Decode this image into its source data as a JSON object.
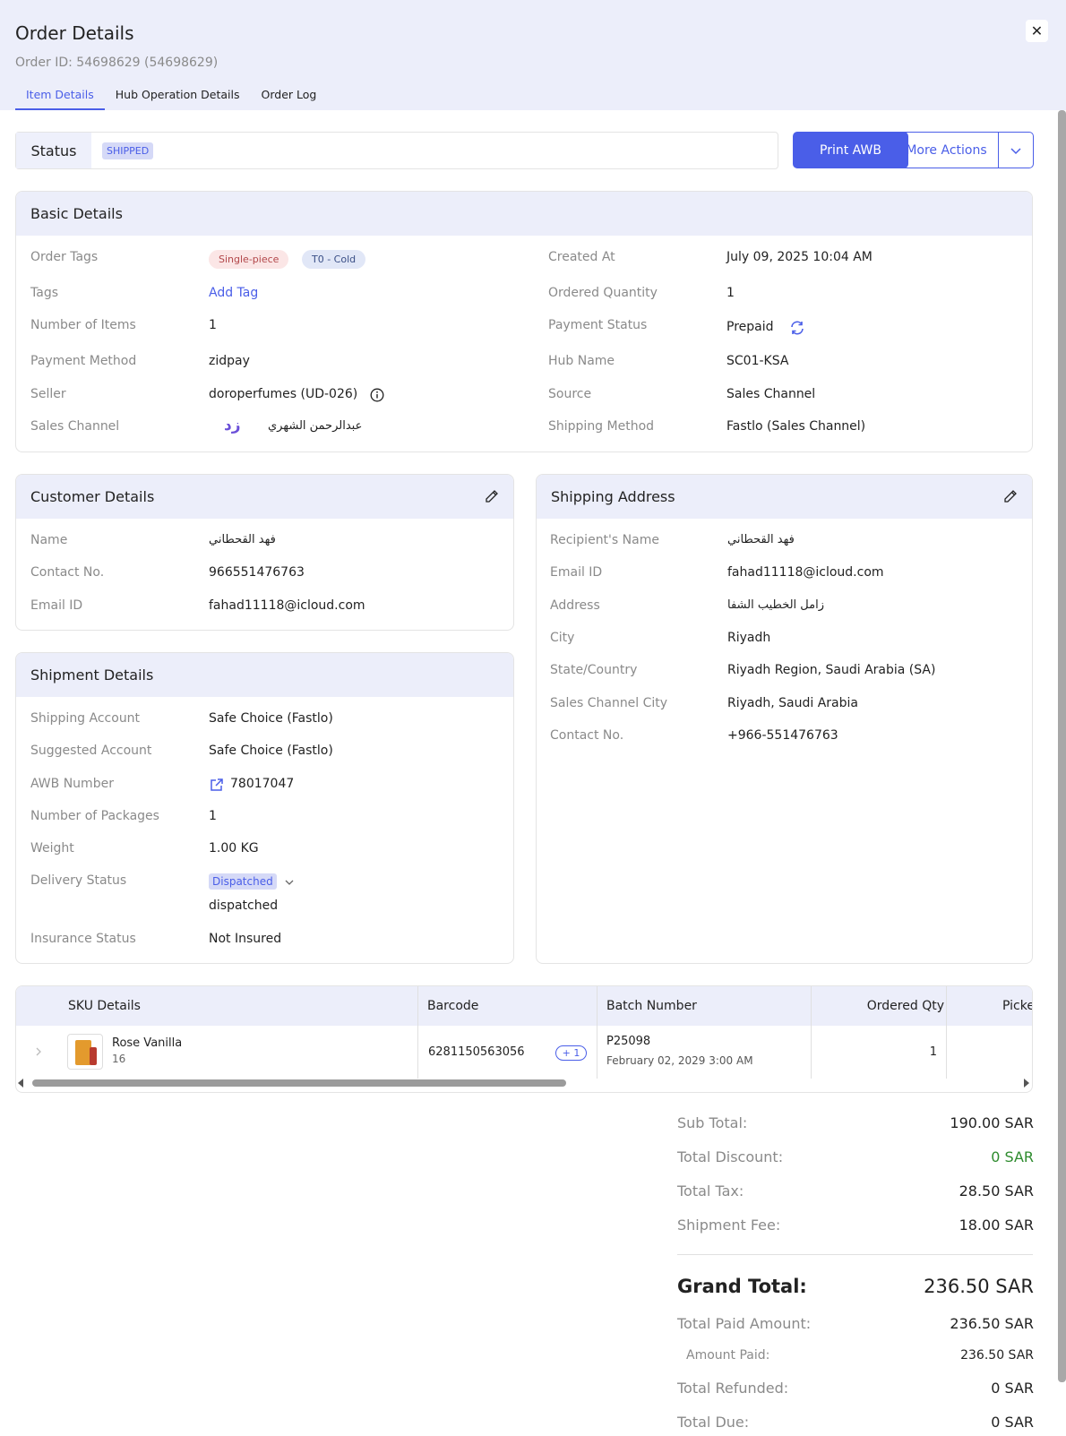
{
  "header": {
    "title": "Order Details",
    "order_id": "Order ID: 54698629 (54698629)",
    "tabs": [
      "Item Details",
      "Hub Operation Details",
      "Order Log"
    ]
  },
  "status": {
    "label": "Status",
    "value": "SHIPPED"
  },
  "actions": {
    "print": "Print AWB",
    "more": "More Actions"
  },
  "basic": {
    "title": "Basic Details",
    "order_tags_label": "Order Tags",
    "order_tags": [
      "Single-piece",
      "T0 - Cold"
    ],
    "tags_label": "Tags",
    "add_tag": "Add Tag",
    "num_items_label": "Number of Items",
    "num_items": "1",
    "payment_method_label": "Payment Method",
    "payment_method": "zidpay",
    "seller_label": "Seller",
    "seller": "doroperfumes (UD-026)",
    "sales_channel_label": "Sales Channel",
    "sales_channel_logo": "زد",
    "sales_channel": "عبدالرحمن الشهري",
    "created_at_label": "Created At",
    "created_at": "July 09, 2025 10:04 AM",
    "ordered_qty_label": "Ordered Quantity",
    "ordered_qty": "1",
    "payment_status_label": "Payment Status",
    "payment_status": "Prepaid",
    "hub_name_label": "Hub Name",
    "hub_name": "SC01-KSA",
    "source_label": "Source",
    "source": "Sales Channel",
    "shipping_method_label": "Shipping Method",
    "shipping_method": "Fastlo (Sales Channel)"
  },
  "customer": {
    "title": "Customer Details",
    "name_label": "Name",
    "name": "فهد القحطاني",
    "contact_label": "Contact No.",
    "contact": "966551476763",
    "email_label": "Email ID",
    "email": "fahad11118@icloud.com"
  },
  "shipping": {
    "title": "Shipping Address",
    "recipient_label": "Recipient's Name",
    "recipient": "فهد القحطاني",
    "email_label": "Email ID",
    "email": "fahad11118@icloud.com",
    "address_label": "Address",
    "address": "زامل الخطيب الشفا",
    "city_label": "City",
    "city": "Riyadh",
    "state_label": "State/Country",
    "state": "Riyadh Region, Saudi Arabia (SA)",
    "sc_city_label": "Sales Channel City",
    "sc_city": "Riyadh, Saudi Arabia",
    "contact_label": "Contact No.",
    "contact": "+966-551476763"
  },
  "shipment": {
    "title": "Shipment Details",
    "account_label": "Shipping Account",
    "account": "Safe Choice (Fastlo)",
    "suggested_label": "Suggested Account",
    "suggested": "Safe Choice (Fastlo)",
    "awb_label": "AWB Number",
    "awb": "78017047",
    "packages_label": "Number of Packages",
    "packages": "1",
    "weight_label": "Weight",
    "weight": "1.00 KG",
    "delivery_label": "Delivery Status",
    "delivery_badge": "Dispatched",
    "delivery_text": "dispatched",
    "insurance_label": "Insurance Status",
    "insurance": "Not Insured"
  },
  "table": {
    "headers": [
      "SKU Details",
      "Barcode",
      "Batch Number",
      "Ordered Qty",
      "Picke"
    ],
    "row": {
      "name": "Rose Vanilla",
      "sku": "16",
      "barcode": "6281150563056",
      "barcode_extra": "+ 1",
      "batch": "P25098",
      "batch_date": "February 02, 2029 3:00 AM",
      "ordered_qty": "1"
    }
  },
  "summary": {
    "sub_total_label": "Sub Total:",
    "sub_total": "190.00 SAR",
    "discount_label": "Total Discount:",
    "discount": "0 SAR",
    "tax_label": "Total Tax:",
    "tax": "28.50 SAR",
    "fee_label": "Shipment Fee:",
    "fee": "18.00 SAR",
    "grand_label": "Grand Total:",
    "grand": "236.50 SAR",
    "paid_total_label": "Total Paid Amount:",
    "paid_total": "236.50 SAR",
    "amount_paid_label": "Amount Paid:",
    "amount_paid": "236.50 SAR",
    "refunded_label": "Total Refunded:",
    "refunded": "0 SAR",
    "due_label": "Total Due:",
    "due": "0 SAR"
  },
  "colors": {
    "accent": "#4a5ee8",
    "header_bg": "#eceefa",
    "discount_green": "#2e8b2e"
  }
}
